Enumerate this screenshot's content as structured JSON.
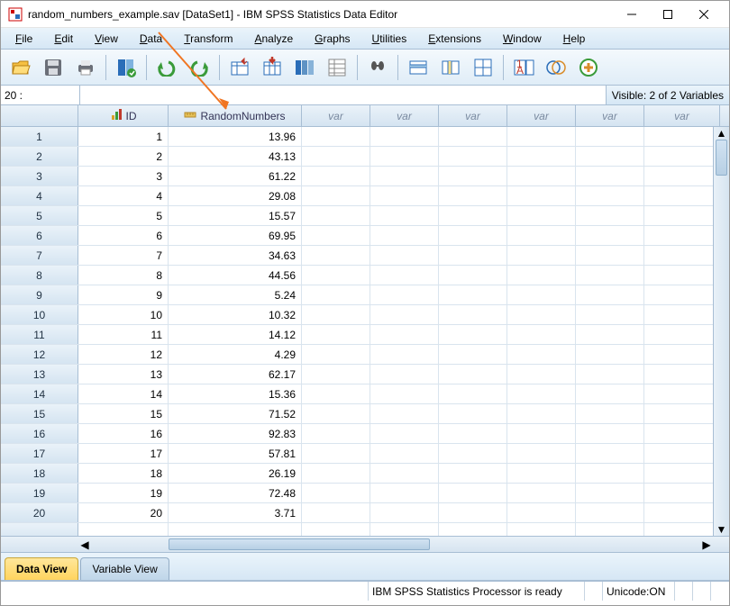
{
  "window": {
    "title": "random_numbers_example.sav [DataSet1] - IBM SPSS Statistics Data Editor"
  },
  "menus": [
    "File",
    "Edit",
    "View",
    "Data",
    "Transform",
    "Analyze",
    "Graphs",
    "Utilities",
    "Extensions",
    "Window",
    "Help"
  ],
  "goto": {
    "label": "20 :",
    "value": "",
    "visible": "Visible: 2 of 2 Variables"
  },
  "columns": {
    "id": "ID",
    "rn": "RandomNumbers",
    "var": "var"
  },
  "rows": [
    {
      "n": "1",
      "id": "1",
      "rn": "13.96"
    },
    {
      "n": "2",
      "id": "2",
      "rn": "43.13"
    },
    {
      "n": "3",
      "id": "3",
      "rn": "61.22"
    },
    {
      "n": "4",
      "id": "4",
      "rn": "29.08"
    },
    {
      "n": "5",
      "id": "5",
      "rn": "15.57"
    },
    {
      "n": "6",
      "id": "6",
      "rn": "69.95"
    },
    {
      "n": "7",
      "id": "7",
      "rn": "34.63"
    },
    {
      "n": "8",
      "id": "8",
      "rn": "44.56"
    },
    {
      "n": "9",
      "id": "9",
      "rn": "5.24"
    },
    {
      "n": "10",
      "id": "10",
      "rn": "10.32"
    },
    {
      "n": "11",
      "id": "11",
      "rn": "14.12"
    },
    {
      "n": "12",
      "id": "12",
      "rn": "4.29"
    },
    {
      "n": "13",
      "id": "13",
      "rn": "62.17"
    },
    {
      "n": "14",
      "id": "14",
      "rn": "15.36"
    },
    {
      "n": "15",
      "id": "15",
      "rn": "71.52"
    },
    {
      "n": "16",
      "id": "16",
      "rn": "92.83"
    },
    {
      "n": "17",
      "id": "17",
      "rn": "57.81"
    },
    {
      "n": "18",
      "id": "18",
      "rn": "26.19"
    },
    {
      "n": "19",
      "id": "19",
      "rn": "72.48"
    },
    {
      "n": "20",
      "id": "20",
      "rn": "3.71"
    }
  ],
  "tabs": {
    "data": "Data View",
    "variable": "Variable View"
  },
  "status": {
    "processor": "IBM SPSS Statistics Processor is ready",
    "unicode": "Unicode:ON"
  },
  "colors": {
    "accent": "#2a6db8",
    "arrow": "#f07522"
  }
}
